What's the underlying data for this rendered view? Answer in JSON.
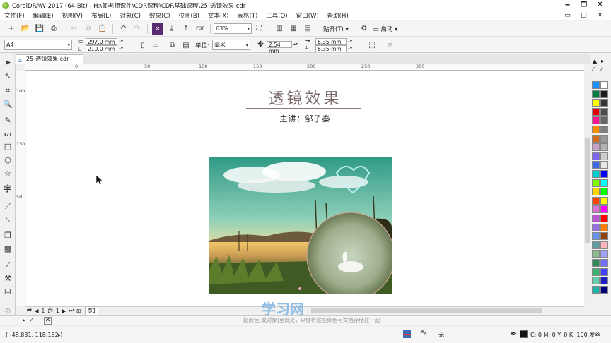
{
  "window": {
    "title": "CorelDRAW 2017 (64-Bit) - H:\\邹老师课件\\CDR课程\\CDR基础课程\\25-透镜效果.cdr",
    "controls": [
      "🗕",
      "🗖",
      "✕"
    ],
    "doc_controls": [
      "▭",
      "□",
      "✕"
    ]
  },
  "menu": {
    "items": [
      "文件(F)",
      "编辑(E)",
      "视图(V)",
      "布局(L)",
      "对象(C)",
      "效果(C)",
      "位图(B)",
      "文本(X)",
      "表格(T)",
      "工具(O)",
      "窗口(W)",
      "帮助(H)"
    ]
  },
  "toolbar": {
    "zoom": "63%",
    "snap_label": "贴齐(T)",
    "launch_label": "启动",
    "pdf_label": "PDF"
  },
  "property_bar": {
    "page_size": "A4",
    "width": "297.0 mm",
    "height": "210.0 mm",
    "units_label": "单位:",
    "units": "毫米",
    "nudge": "2.54 mm",
    "dup_x": "6.35 mm",
    "dup_y": "6.35 mm"
  },
  "document": {
    "tab_label": "25-透镜效果.cdr"
  },
  "rulers": {
    "h_ticks": [
      "300",
      "0",
      "50",
      "100",
      "150",
      "200",
      "250",
      "300"
    ],
    "v_ticks": [
      "100",
      "150",
      "50"
    ]
  },
  "canvas": {
    "heading": "透镜效果",
    "subheading": "主讲：邹子秦"
  },
  "page_nav": {
    "current": "1",
    "of_label": "的",
    "total": "1",
    "page_tab": "页1"
  },
  "watermark": {
    "main": "学习网",
    "sub": "拖颜色(或对象)至此处，以便将这些颜色与文档存储在一起"
  },
  "status": {
    "coords": "( -48.831, 118.152 )",
    "fill_label": "无",
    "outline_info": "C: 0 M: 0 Y: 0 K: 100 发丝"
  },
  "palette_colors": [
    "#1e90ff",
    "#ffffff",
    "#007f3f",
    "#1a1a1a",
    "#ffff00",
    "#333333",
    "#e00000",
    "#4d4d4d",
    "#ff1493",
    "#666666",
    "#ff8c00",
    "#808080",
    "#d2691e",
    "#999999",
    "#c8a2c8",
    "#b3b3b3",
    "#7b68ee",
    "#cccccc",
    "#4169e1",
    "#e6e6e6",
    "#00ced1",
    "#0000ff",
    "#7fff00",
    "#00ffff",
    "#ffd700",
    "#00ff00",
    "#ff4500",
    "#ffff00",
    "#da70d6",
    "#ff00ff",
    "#ba55d3",
    "#ff0000",
    "#9370db",
    "#ff8000",
    "#6495ed",
    "#8b4513",
    "#5f9ea0",
    "#ffb6c1",
    "#8fbc8f",
    "#a0a0ff",
    "#2e8b57",
    "#7070ff",
    "#3cb371",
    "#4040ff",
    "#66cdaa",
    "#2020c0",
    "#20b2aa",
    "#000080"
  ]
}
